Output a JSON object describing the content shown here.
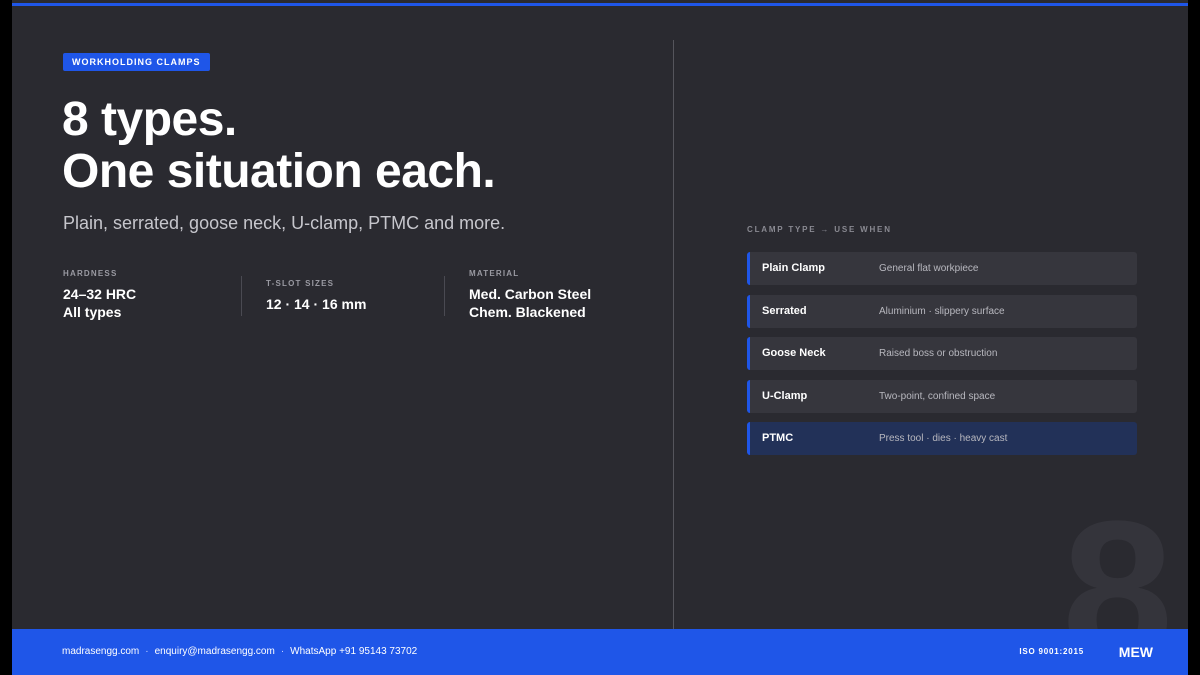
{
  "badge": "WORKHOLDING CLAMPS",
  "headline": {
    "line1": "8 types.",
    "line2": "One situation each."
  },
  "subtitle": "Plain, serrated, goose neck, U-clamp, PTMC and more.",
  "stats": [
    {
      "label": "HARDNESS",
      "lines": [
        "24–32 HRC",
        "All types"
      ]
    },
    {
      "label": "T-SLOT SIZES",
      "lines": [
        "12 · 14 · 16 mm"
      ]
    },
    {
      "label": "MATERIAL",
      "lines": [
        "Med. Carbon Steel",
        "Chem. Blackened"
      ]
    }
  ],
  "clamp_list": {
    "title": "CLAMP TYPE → USE WHEN",
    "rows": [
      {
        "name": "Plain Clamp",
        "use": "General flat workpiece",
        "active": false
      },
      {
        "name": "Serrated",
        "use": "Aluminium · slippery surface",
        "active": false
      },
      {
        "name": "Goose Neck",
        "use": "Raised boss or obstruction",
        "active": false
      },
      {
        "name": "U-Clamp",
        "use": "Two-point, confined space",
        "active": false
      },
      {
        "name": "PTMC",
        "use": "Press tool · dies · heavy cast",
        "active": true
      }
    ]
  },
  "big_numeral": "8",
  "footer": {
    "website": "madrasengg.com",
    "email": "enquiry@madrasengg.com",
    "whatsapp": "WhatsApp +91 95143 73702",
    "separator": "·",
    "certification": "ISO 9001:2015",
    "brand": "MEW"
  },
  "colors": {
    "accent": "#1f56e8",
    "background": "#2a2a30",
    "row": "#36363d",
    "row_active": "#223158"
  }
}
